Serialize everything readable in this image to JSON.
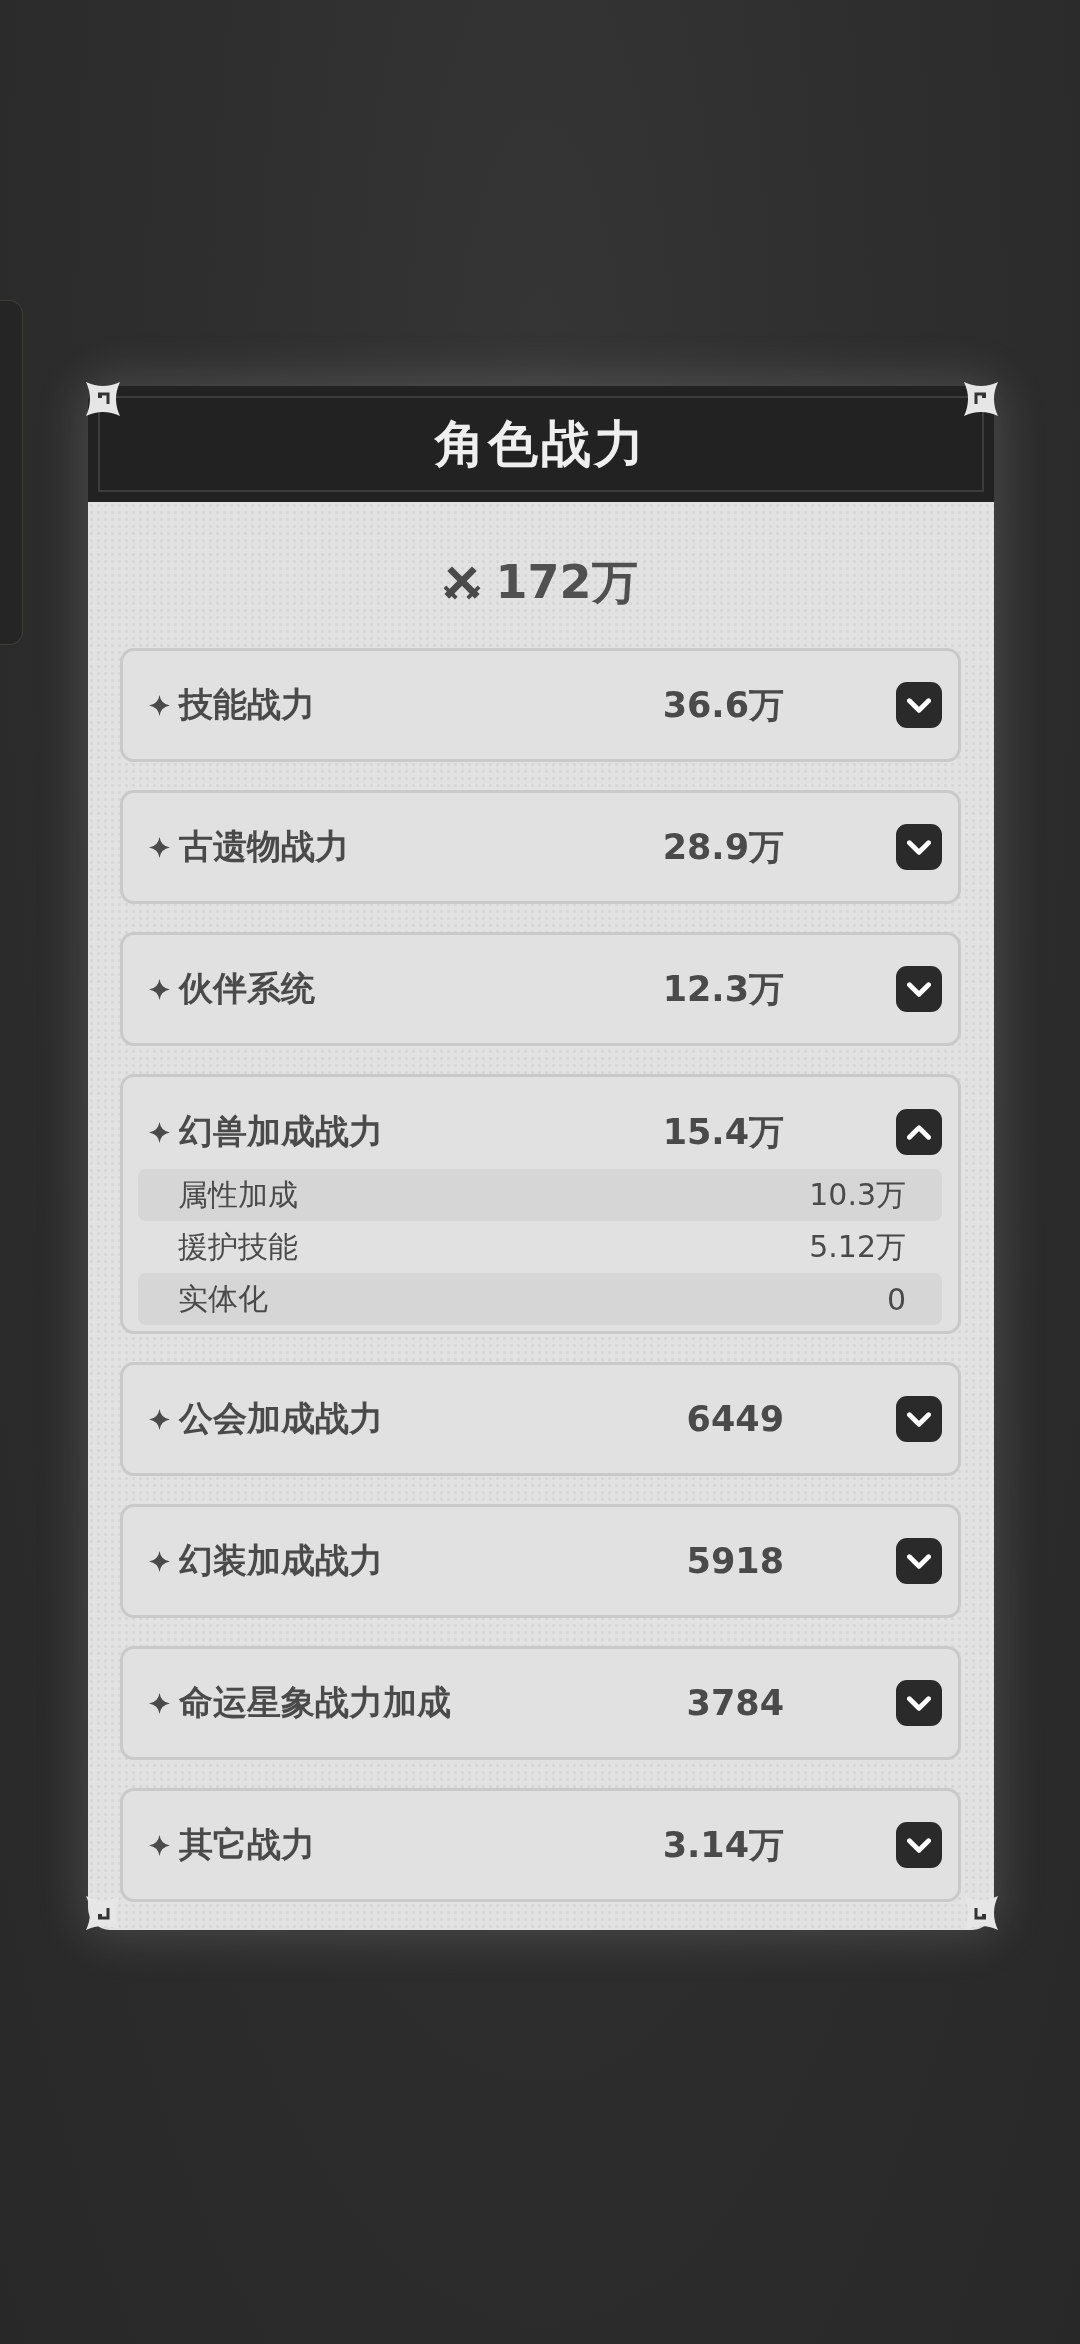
{
  "dialog": {
    "title": "角色战力"
  },
  "total": {
    "value": "172万"
  },
  "rows": [
    {
      "label": "技能战力",
      "value": "36.6万",
      "expanded": false
    },
    {
      "label": "古遗物战力",
      "value": "28.9万",
      "expanded": false
    },
    {
      "label": "伙伴系统",
      "value": "12.3万",
      "expanded": false
    },
    {
      "label": "幻兽加成战力",
      "value": "15.4万",
      "expanded": true,
      "details": [
        {
          "label": "属性加成",
          "value": "10.3万"
        },
        {
          "label": "援护技能",
          "value": "5.12万"
        },
        {
          "label": "实体化",
          "value": "0"
        }
      ]
    },
    {
      "label": "公会加成战力",
      "value": "6449",
      "expanded": false
    },
    {
      "label": "幻装加成战力",
      "value": "5918",
      "expanded": false
    },
    {
      "label": "命运星象战力加成",
      "value": "3784",
      "expanded": false
    },
    {
      "label": "其它战力",
      "value": "3.14万",
      "expanded": false
    }
  ]
}
